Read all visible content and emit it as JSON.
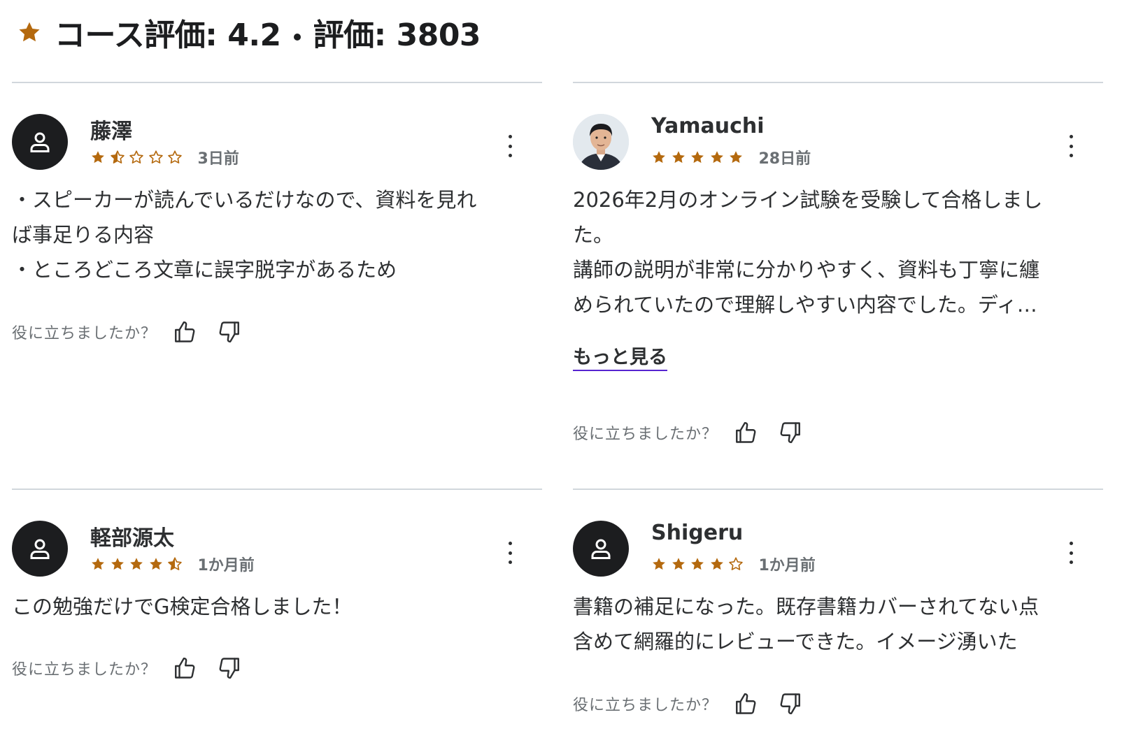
{
  "header": {
    "star_icon": "star-icon",
    "course_rating_label": "コース評価: 4.2",
    "ratings_count_label": "評価: 3803",
    "accent_color": "#b4690e"
  },
  "helpful_label": "役に立ちましたか？",
  "reviews": [
    {
      "name": "藤澤",
      "avatar": "user-icon",
      "rating": 1.5,
      "date": "3日前",
      "lines": [
        "・スピーカーが読んでいるだけなので、資料を見れ",
        "ば事足りる内容",
        "・ところどころ文章に誤字脱字があるため"
      ]
    },
    {
      "name": "Yamauchi",
      "avatar": "photo",
      "rating": 5,
      "date": "28日前",
      "lines": [
        "2026年2月のオンライン試験を受験して合格しまし",
        "た。",
        "講師の説明が非常に分かりやすく、資料も丁寧に纏",
        "められていたので理解しやすい内容でした。ディ…"
      ],
      "show_more": "もっと見る"
    },
    {
      "name": "軽部源太",
      "avatar": "user-icon",
      "rating": 4.5,
      "date": "1か月前",
      "lines": [
        "この勉強だけでG検定合格しました！"
      ]
    },
    {
      "name": "Shigeru",
      "avatar": "user-icon",
      "rating": 4,
      "date": "1か月前",
      "lines": [
        "書籍の補足になった。既存書籍カバーされてない点",
        "含めて網羅的にレビューできた。イメージ湧いた"
      ]
    }
  ]
}
